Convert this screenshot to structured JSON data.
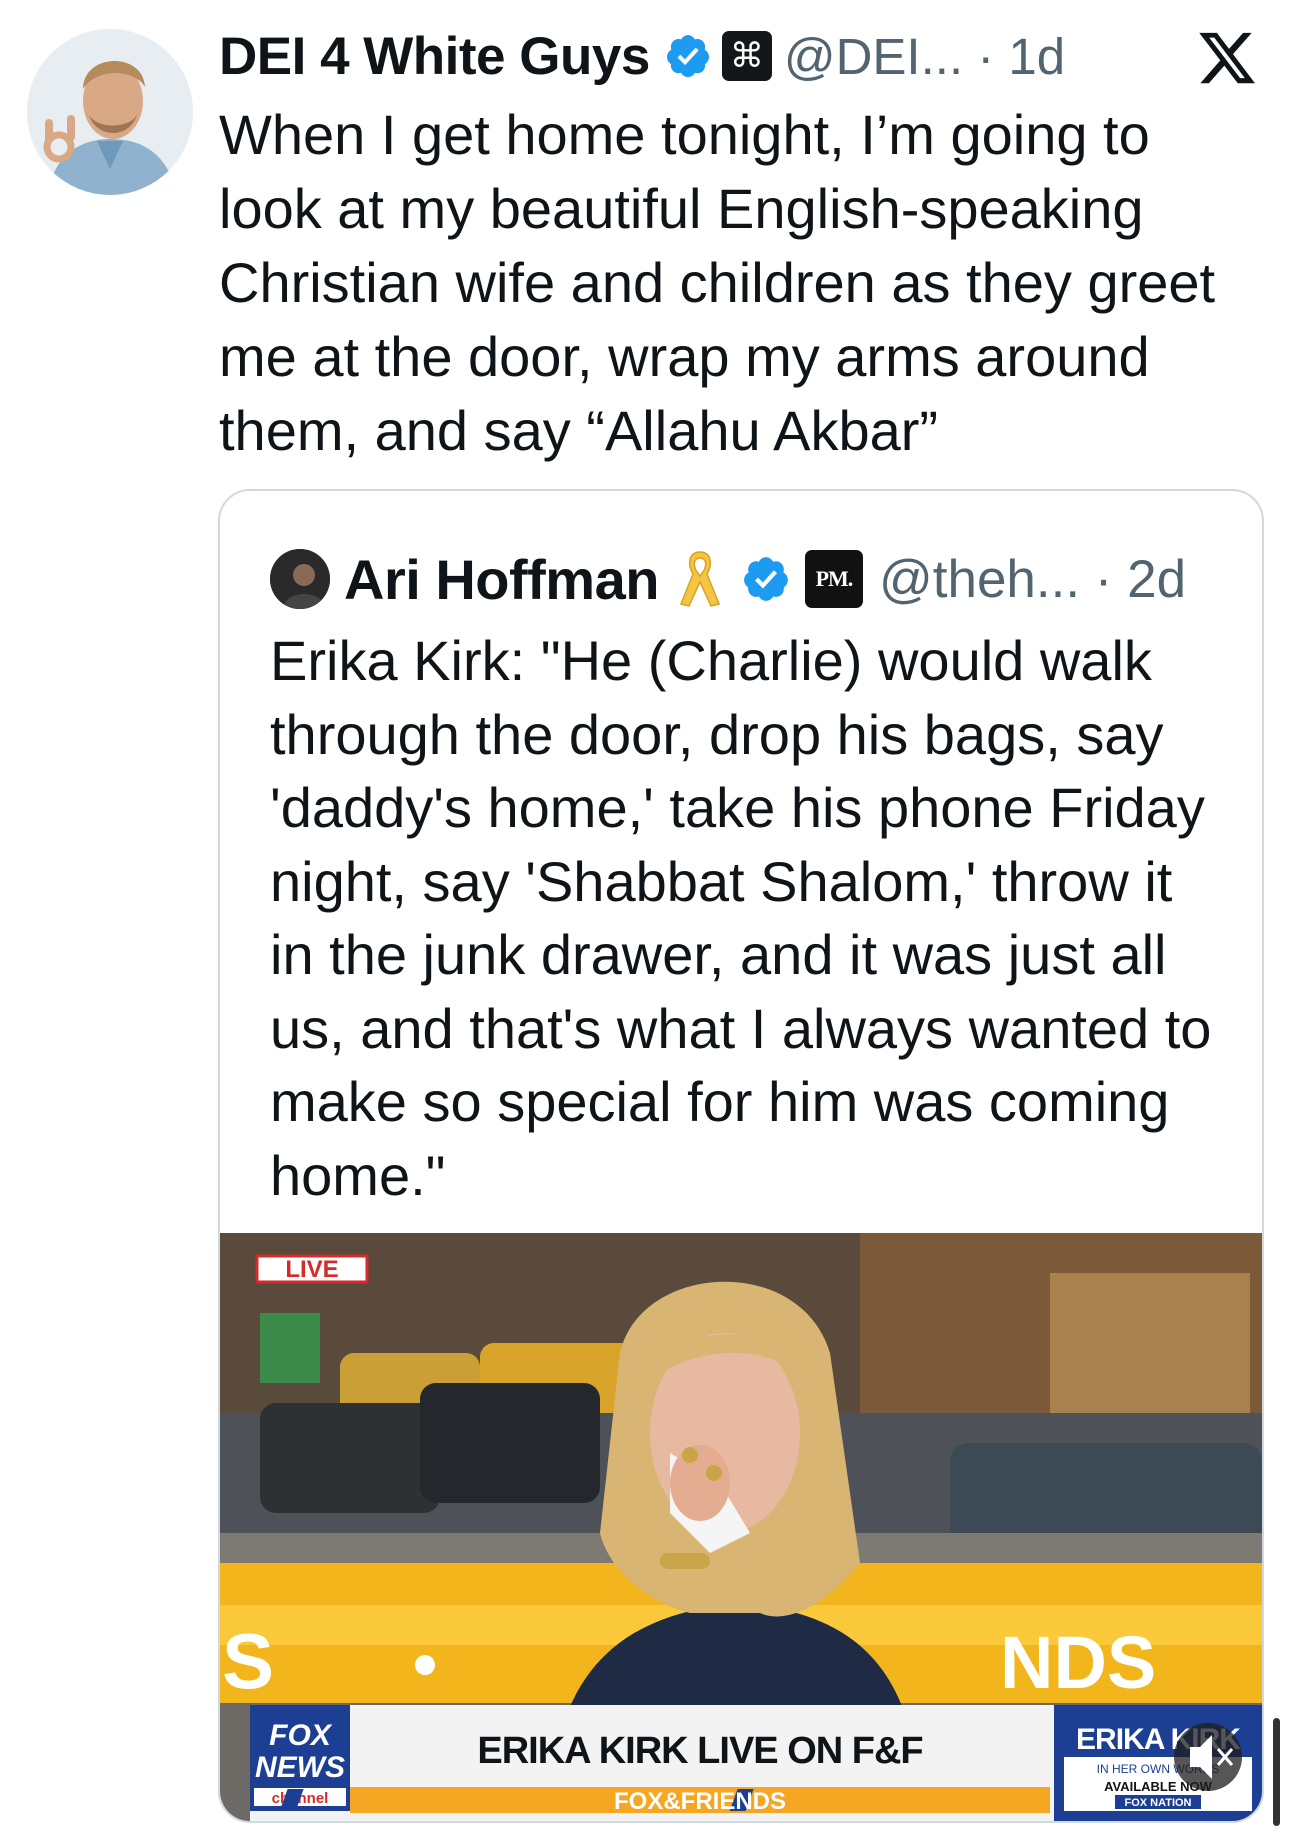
{
  "tweet": {
    "author_name": "DEI 4 White Guys",
    "author_avatar_icon": "profile-photo-man-ok-gesture",
    "verified_icon": "verified-badge-icon",
    "affiliation_icon": "command-key-badge-icon",
    "affiliation_symbol": "⌘",
    "handle_time": "@DEI... · 1d",
    "platform_icon": "x-logo-icon",
    "text": "When I get home tonight, I’m going to look at my beautiful English-speaking Christian wife and children as they greet me at the door, wrap my arms around them, and say “Allahu Akbar”"
  },
  "quoted_tweet": {
    "author_name": "Ari Hoffman",
    "ribbon_icon": "yellow-ribbon-icon",
    "verified_icon": "verified-badge-icon",
    "affiliation_label": "PM.",
    "handle_time": "@theh... · 2d",
    "text": "Erika Kirk: \"He (Charlie) would walk through the door, drop his bags, say 'daddy's home,' take his phone Friday night, say 'Shabbat Shalom,' throw it in the junk drawer, and it was just all us, and that's what I always wanted to make so special for him was coming home.\""
  },
  "video": {
    "live_badge": "LIVE",
    "background_left_letter": "S",
    "background_right_letters": "NDS",
    "chyron_headline": "ERIKA KIRK LIVE ON F&F",
    "chyron_program": "FOX&FRIENDS",
    "network_logo": [
      "FOX",
      "NEWS",
      "channel"
    ],
    "promo_title": "ERIKA KIRK",
    "promo_subtitle": "IN HER OWN WORDS",
    "promo_cta": "AVAILABLE NOW",
    "promo_brand": "FOX NATION",
    "mute_icon": "speaker-muted-icon",
    "colors": {
      "fox_blue": "#1c3f94",
      "chyron_orange": "#f5a623",
      "live_red": "#d62b2b"
    }
  },
  "colors": {
    "verified_blue": "#1d9bf0",
    "text": "#0f1419",
    "muted": "#536471",
    "ribbon_yellow": "#f4c542"
  }
}
